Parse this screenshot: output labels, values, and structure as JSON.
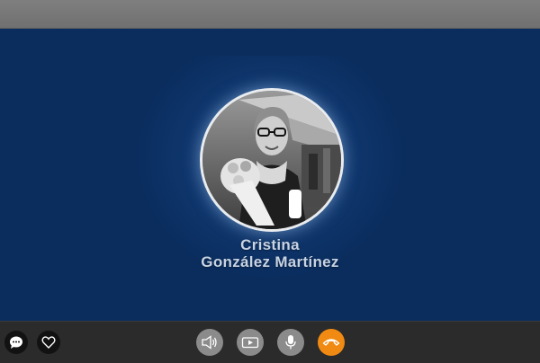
{
  "call": {
    "caller_first_name": "Cristina",
    "caller_last_name": "González Martínez"
  },
  "controls": {
    "left": [
      {
        "icon": "chat-icon"
      },
      {
        "icon": "heart-icon"
      }
    ],
    "center": [
      {
        "icon": "speaker-icon"
      },
      {
        "icon": "video-camera-icon"
      },
      {
        "icon": "microphone-icon"
      },
      {
        "icon": "hang-up-icon"
      }
    ]
  },
  "colors": {
    "background": "#0a2d5e",
    "top_bar": "#777777",
    "bottom_bar": "#2b2b2b",
    "control_grey": "#8b8b8b",
    "hang_up": "#f08a12",
    "name_text": "#c8d3e2"
  }
}
